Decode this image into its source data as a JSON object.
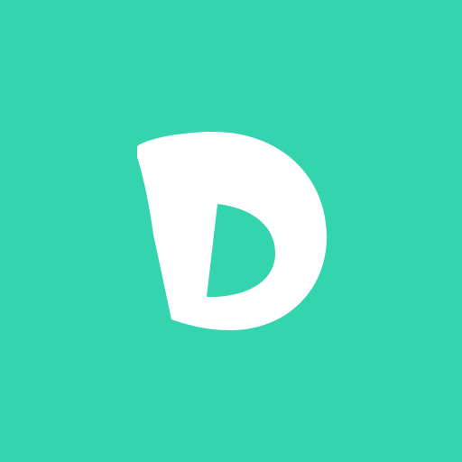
{
  "icon": {
    "name": "d-logo-icon",
    "background_color": "#34d4ae",
    "glyph_color": "#ffffff"
  }
}
